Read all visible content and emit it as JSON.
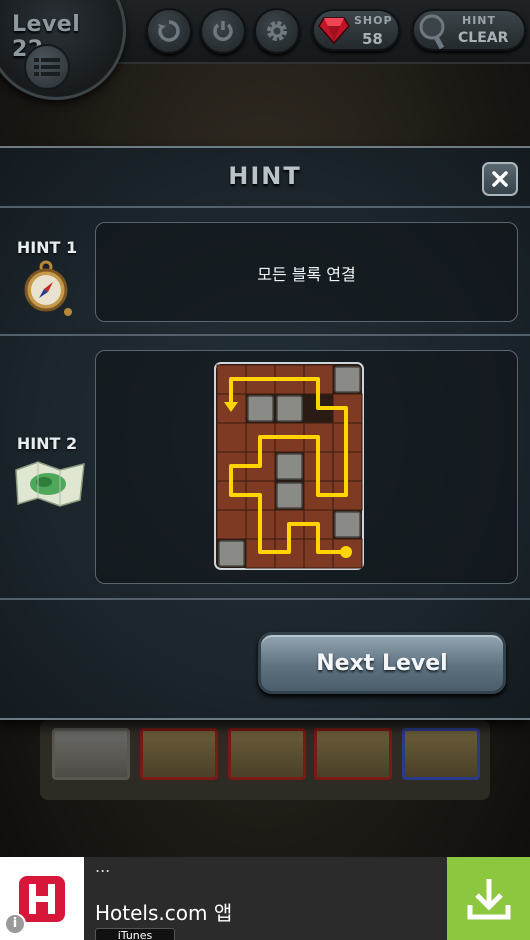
{
  "top_bar": {
    "level_label": "Level 22",
    "shop": {
      "label": "SHOP",
      "value": "58"
    },
    "hint": {
      "label": "HINT",
      "sub": "CLEAR"
    }
  },
  "modal": {
    "title": "HINT",
    "hint1": {
      "label": "HINT 1",
      "text": "모든 블록 연결"
    },
    "hint2": {
      "label": "HINT 2"
    },
    "next_button": "Next Level"
  },
  "ad": {
    "dots": "...",
    "title": "Hotels.com 앱",
    "store": "iTunes",
    "info": "i",
    "colors": {
      "logo": "#d6173a",
      "download": "#8dc63f"
    }
  },
  "colors": {
    "path": "#ffd400",
    "bg_tile_border": "#7a1a14"
  }
}
